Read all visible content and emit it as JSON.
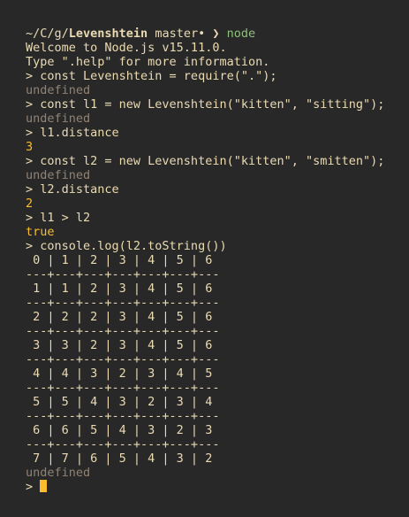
{
  "prompt": {
    "path_prefix": "~/C/g/",
    "dir": "Levenshtein",
    "branch": " master•",
    "arrow": " ❯ ",
    "command": "node"
  },
  "lines": [
    {
      "segments": [
        {
          "text": "Welcome to Node.js v15.11.0.",
          "color": "fg"
        }
      ]
    },
    {
      "segments": [
        {
          "text": "Type \".help\" for more information.",
          "color": "fg"
        }
      ]
    },
    {
      "segments": [
        {
          "text": "> const Levenshtein = require(\".\");",
          "color": "fg"
        }
      ]
    },
    {
      "segments": [
        {
          "text": "undefined",
          "color": "gray"
        }
      ]
    },
    {
      "segments": [
        {
          "text": "> const l1 = new Levenshtein(\"kitten\", \"sitting\");",
          "color": "fg"
        }
      ]
    },
    {
      "segments": [
        {
          "text": "undefined",
          "color": "gray"
        }
      ]
    },
    {
      "segments": [
        {
          "text": "> l1.distance",
          "color": "fg"
        }
      ]
    },
    {
      "segments": [
        {
          "text": "3",
          "color": "yellow"
        }
      ]
    },
    {
      "segments": [
        {
          "text": "> const l2 = new Levenshtein(\"kitten\", \"smitten\");",
          "color": "fg"
        }
      ]
    },
    {
      "segments": [
        {
          "text": "undefined",
          "color": "gray"
        }
      ]
    },
    {
      "segments": [
        {
          "text": "> l2.distance",
          "color": "fg"
        }
      ]
    },
    {
      "segments": [
        {
          "text": "2",
          "color": "yellow"
        }
      ]
    },
    {
      "segments": [
        {
          "text": "> l1 > l2",
          "color": "fg"
        }
      ]
    },
    {
      "segments": [
        {
          "text": "true",
          "color": "yellow"
        }
      ]
    },
    {
      "segments": [
        {
          "text": "> console.log(l2.toString())",
          "color": "fg"
        }
      ]
    },
    {
      "segments": [
        {
          "text": " 0 | 1 | 2 | 3 | 4 | 5 | 6",
          "color": "fg"
        }
      ]
    },
    {
      "segments": [
        {
          "text": "---+---+---+---+---+---+---",
          "color": "fg"
        }
      ]
    },
    {
      "segments": [
        {
          "text": " 1 | 1 | 2 | 3 | 4 | 5 | 6",
          "color": "fg"
        }
      ]
    },
    {
      "segments": [
        {
          "text": "---+---+---+---+---+---+---",
          "color": "fg"
        }
      ]
    },
    {
      "segments": [
        {
          "text": " 2 | 2 | 2 | 3 | 4 | 5 | 6",
          "color": "fg"
        }
      ]
    },
    {
      "segments": [
        {
          "text": "---+---+---+---+---+---+---",
          "color": "fg"
        }
      ]
    },
    {
      "segments": [
        {
          "text": " 3 | 3 | 2 | 3 | 4 | 5 | 6",
          "color": "fg"
        }
      ]
    },
    {
      "segments": [
        {
          "text": "---+---+---+---+---+---+---",
          "color": "fg"
        }
      ]
    },
    {
      "segments": [
        {
          "text": " 4 | 4 | 3 | 2 | 3 | 4 | 5",
          "color": "fg"
        }
      ]
    },
    {
      "segments": [
        {
          "text": "---+---+---+---+---+---+---",
          "color": "fg"
        }
      ]
    },
    {
      "segments": [
        {
          "text": " 5 | 5 | 4 | 3 | 2 | 3 | 4",
          "color": "fg"
        }
      ]
    },
    {
      "segments": [
        {
          "text": "---+---+---+---+---+---+---",
          "color": "fg"
        }
      ]
    },
    {
      "segments": [
        {
          "text": " 6 | 6 | 5 | 4 | 3 | 2 | 3",
          "color": "fg"
        }
      ]
    },
    {
      "segments": [
        {
          "text": "---+---+---+---+---+---+---",
          "color": "fg"
        }
      ]
    },
    {
      "segments": [
        {
          "text": " 7 | 7 | 6 | 5 | 4 | 3 | 2",
          "color": "fg"
        }
      ]
    },
    {
      "segments": [
        {
          "text": "undefined",
          "color": "gray"
        }
      ]
    }
  ],
  "input_prompt": "> ",
  "colors": {
    "background": "#282828",
    "foreground": "#ebdbb2",
    "gray": "#928374",
    "yellow": "#fabd2f",
    "green": "#8ec07c",
    "cursor": "#fabd2f"
  }
}
